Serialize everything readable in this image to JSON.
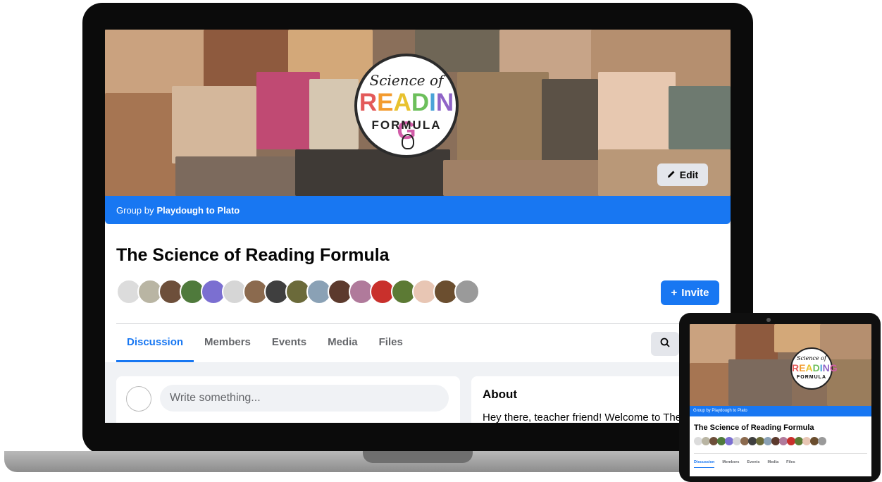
{
  "colors": {
    "brand": "#1877f2",
    "surface": "#ffffff",
    "background": "#f0f2f5"
  },
  "cover": {
    "logo_script": "Science of",
    "logo_reading_letters": [
      {
        "ch": "R",
        "color": "#e35a5a"
      },
      {
        "ch": "E",
        "color": "#f39b2f"
      },
      {
        "ch": "A",
        "color": "#e8c22f"
      },
      {
        "ch": "D",
        "color": "#6cbf5b"
      },
      {
        "ch": "I",
        "color": "#4aa3d8"
      },
      {
        "ch": "N",
        "color": "#8f64c7"
      },
      {
        "ch": "G",
        "color": "#d15ca8"
      }
    ],
    "logo_reading": "READING",
    "logo_formula": "FORMULA",
    "edit_icon": "pencil-icon",
    "edit_label": "Edit"
  },
  "group_bar": {
    "prefix": "Group by",
    "owner": "Playdough to Plato"
  },
  "group": {
    "title": "The Science of Reading Formula",
    "invite_icon": "plus-icon",
    "invite_label": "Invite",
    "member_avatar_colors": [
      "#dcdcdc",
      "#b9b5a3",
      "#6d4f3a",
      "#4f7a3c",
      "#7b6fd1",
      "#d6d6d6",
      "#8b6a4e",
      "#3f3f3f",
      "#6b6a3a",
      "#8aa1b5",
      "#5c3a2d",
      "#b07a9b",
      "#c9302c",
      "#5c7a34",
      "#e8c6b4",
      "#6b4e2f",
      "#9a9a9a"
    ],
    "tabs": [
      {
        "label": "Discussion",
        "active": true
      },
      {
        "label": "Members",
        "active": false
      },
      {
        "label": "Events",
        "active": false
      },
      {
        "label": "Media",
        "active": false
      },
      {
        "label": "Files",
        "active": false
      }
    ],
    "search_icon": "search-icon"
  },
  "composer": {
    "placeholder": "Write something..."
  },
  "about": {
    "title": "About",
    "text": "Hey there, teacher friend! Welcome to The"
  },
  "tablet": {
    "logo_script": "Science of",
    "logo_reading": "READING",
    "logo_formula": "FORMULA",
    "group_bar": "Group by Playdough to Plato",
    "title": "The Science of Reading Formula",
    "tabs": [
      "Discussion",
      "Members",
      "Events",
      "Media",
      "Files"
    ]
  }
}
